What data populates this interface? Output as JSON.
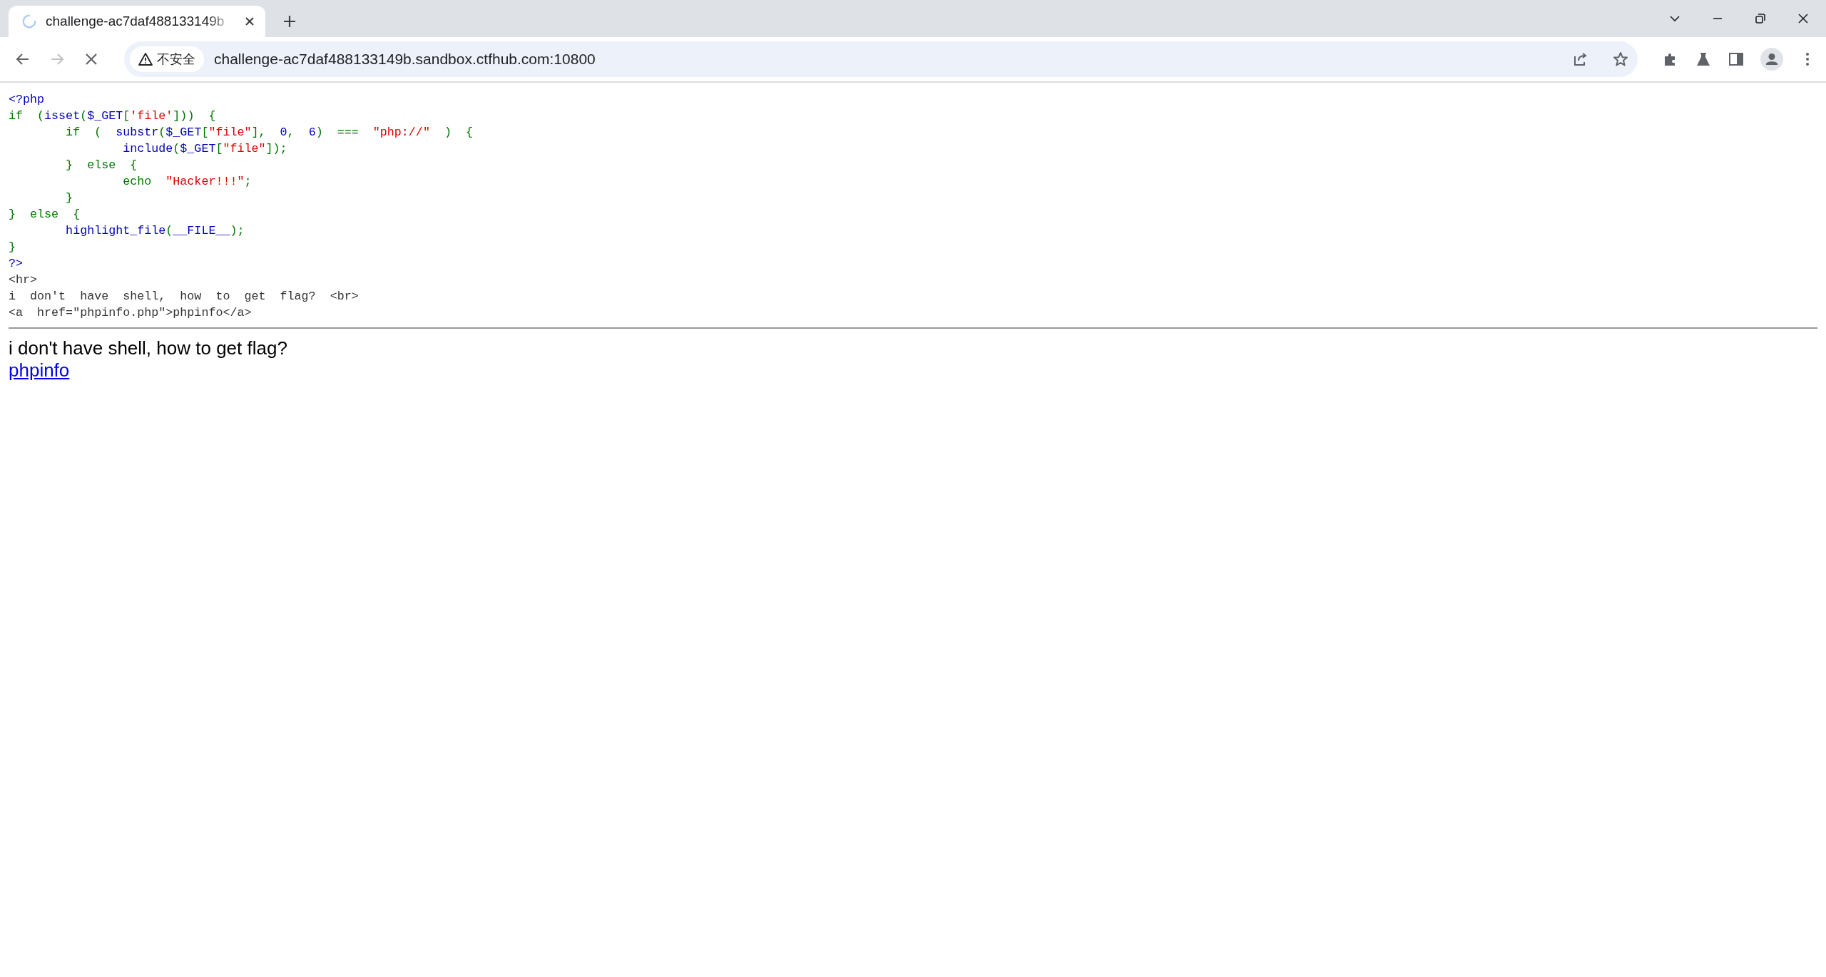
{
  "browser": {
    "loading": true,
    "tabs": [
      {
        "title": "challenge-ac7daf488133149b",
        "selected": true
      }
    ],
    "address_bar": {
      "security_label": "不安全",
      "url": "challenge-ac7daf488133149b.sandbox.ctfhub.com:10800"
    }
  },
  "page": {
    "source_lines": [
      [
        {
          "kind": "default",
          "t": "<?php"
        }
      ],
      [
        {
          "kind": "keyword",
          "t": "if  ("
        },
        {
          "kind": "default",
          "t": "isset"
        },
        {
          "kind": "keyword",
          "t": "("
        },
        {
          "kind": "default",
          "t": "$_GET"
        },
        {
          "kind": "keyword",
          "t": "["
        },
        {
          "kind": "string",
          "t": "'file'"
        },
        {
          "kind": "keyword",
          "t": "]))  {"
        }
      ],
      [
        {
          "kind": "keyword",
          "t": "        if  (  "
        },
        {
          "kind": "default",
          "t": "substr"
        },
        {
          "kind": "keyword",
          "t": "("
        },
        {
          "kind": "default",
          "t": "$_GET"
        },
        {
          "kind": "keyword",
          "t": "["
        },
        {
          "kind": "string",
          "t": "\"file\""
        },
        {
          "kind": "keyword",
          "t": "],  "
        },
        {
          "kind": "default",
          "t": "0"
        },
        {
          "kind": "keyword",
          "t": ",  "
        },
        {
          "kind": "default",
          "t": "6"
        },
        {
          "kind": "keyword",
          "t": ")  ===  "
        },
        {
          "kind": "string",
          "t": "\"php://\""
        },
        {
          "kind": "keyword",
          "t": "  )  {"
        }
      ],
      [
        {
          "kind": "default",
          "t": "                include"
        },
        {
          "kind": "keyword",
          "t": "("
        },
        {
          "kind": "default",
          "t": "$_GET"
        },
        {
          "kind": "keyword",
          "t": "["
        },
        {
          "kind": "string",
          "t": "\"file\""
        },
        {
          "kind": "keyword",
          "t": "]);"
        }
      ],
      [
        {
          "kind": "keyword",
          "t": "        }  else  {"
        }
      ],
      [
        {
          "kind": "keyword",
          "t": "                echo  "
        },
        {
          "kind": "string",
          "t": "\"Hacker!!!\""
        },
        {
          "kind": "keyword",
          "t": ";"
        }
      ],
      [
        {
          "kind": "keyword",
          "t": "        }"
        }
      ],
      [
        {
          "kind": "keyword",
          "t": "}  else  {"
        }
      ],
      [
        {
          "kind": "default",
          "t": "        highlight_file"
        },
        {
          "kind": "keyword",
          "t": "("
        },
        {
          "kind": "default",
          "t": "__FILE__"
        },
        {
          "kind": "keyword",
          "t": ");"
        }
      ],
      [
        {
          "kind": "keyword",
          "t": "}"
        }
      ],
      [
        {
          "kind": "default",
          "t": "?>"
        }
      ],
      [
        {
          "kind": "html",
          "t": "<hr>"
        }
      ],
      [
        {
          "kind": "html",
          "t": "i  don't  have  shell,  how  to  get  flag?  <br>"
        }
      ],
      [
        {
          "kind": "html",
          "t": "<a  href=\"phpinfo.php\">phpinfo</a>"
        }
      ]
    ],
    "message": "i don't have shell, how to get flag?",
    "link": "phpinfo"
  }
}
